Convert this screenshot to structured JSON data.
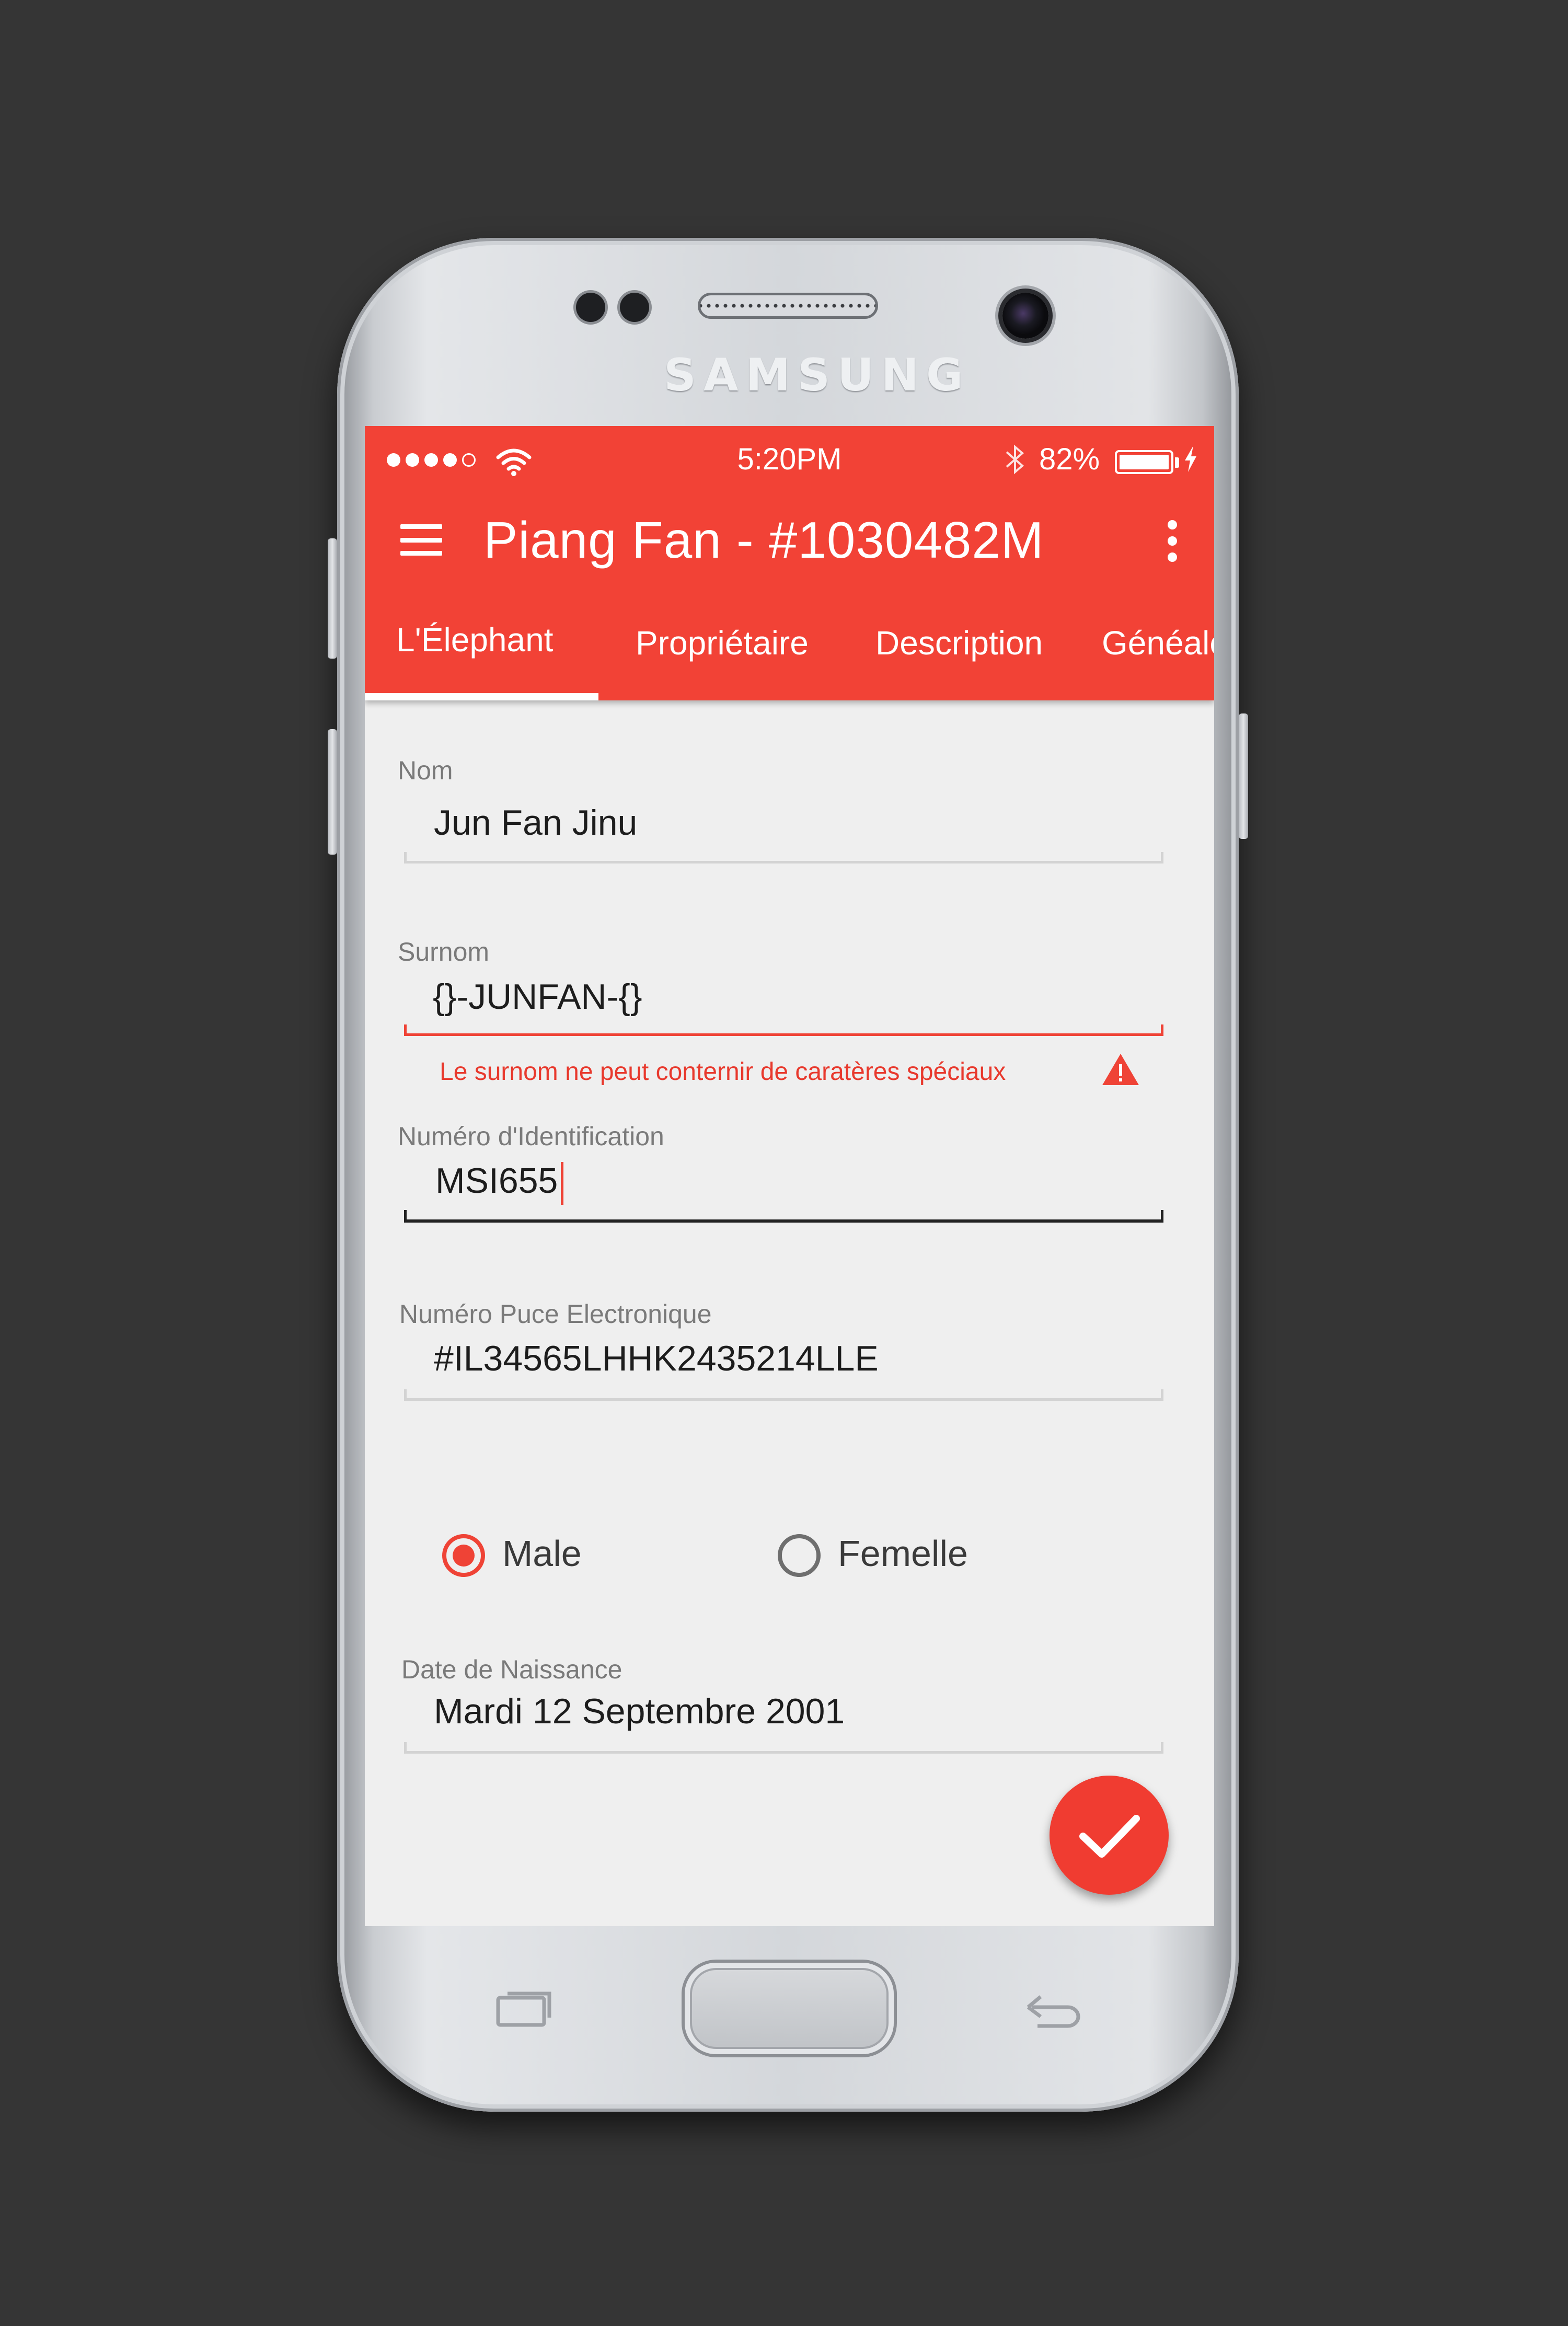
{
  "device": {
    "brand": "SAMSUNG"
  },
  "status_bar": {
    "time": "5:20PM",
    "battery_percent": "82%",
    "signal_bars": 4
  },
  "toolbar": {
    "title": "Piang Fan - #1030482M"
  },
  "tabs": [
    {
      "label": "L'Élephant",
      "active": true
    },
    {
      "label": "Propriétaire",
      "active": false
    },
    {
      "label": "Description",
      "active": false
    },
    {
      "label": "Généalo",
      "active": false
    }
  ],
  "form": {
    "nom": {
      "label": "Nom",
      "value": "Jun Fan Jinu"
    },
    "surnom": {
      "label": "Surnom",
      "value": "{}-JUNFAN-{}",
      "error": "Le surnom ne peut conternir de caratères spéciaux"
    },
    "identification": {
      "label": "Numéro d'Identification",
      "value": "MSI655"
    },
    "puce": {
      "label": "Numéro Puce Electronique",
      "value": "#IL34565LHHK2435214LLE"
    },
    "sexe": {
      "options": [
        {
          "label": "Male",
          "checked": true
        },
        {
          "label": "Femelle",
          "checked": false
        }
      ]
    },
    "naissance": {
      "label": "Date de Naissance",
      "value": "Mardi 12 Septembre 2001"
    }
  },
  "colors": {
    "primary": "#f24236",
    "error": "#e8392d",
    "background": "#efefef"
  },
  "icons": [
    "menu-icon",
    "overflow-menu-icon",
    "wifi-icon",
    "bluetooth-icon",
    "battery-icon",
    "warning-icon",
    "check-icon",
    "recent-apps-icon",
    "back-icon"
  ]
}
